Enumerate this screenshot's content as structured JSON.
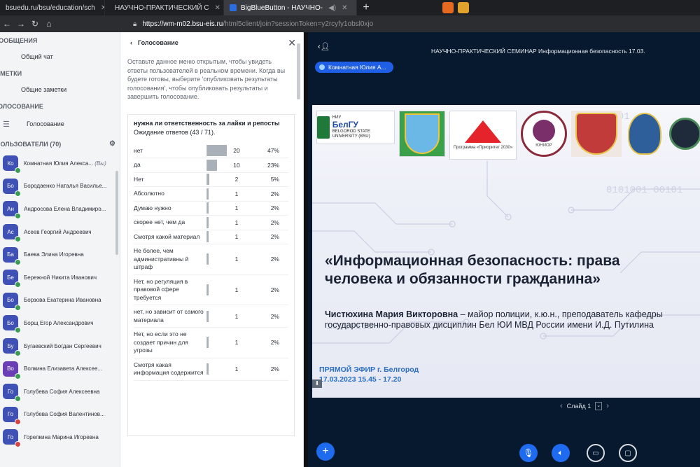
{
  "browser": {
    "tabs": [
      {
        "label": "bsuedu.ru/bsu/education/sch",
        "active": false
      },
      {
        "label": "НАУЧНО-ПРАКТИЧЕСКИЙ С",
        "active": false
      },
      {
        "label": "BigBlueButton - НАУЧНО-",
        "active": true
      }
    ],
    "new_tab": "+",
    "url_host": "https://wm-m02.bsu-eis.ru",
    "url_path": "/html5client/join?sessionToken=y2rcyfy1obsl0xjo"
  },
  "sidebar": {
    "messages_title": "СООБЩЕНИЯ",
    "public_chat": "Общий чат",
    "notes_title": "ЗАМЕТКИ",
    "shared_notes": "Общие заметки",
    "voting_title": "ГОЛОСОВАНИЕ",
    "voting_item": "Голосование",
    "users_title": "ПОЛЬЗОВАТЕЛИ (70)",
    "users": [
      {
        "initials": "Ко",
        "name": "Комнатная Юлия Алекса...",
        "suffix": "(Вы)",
        "color": "#3f51b5",
        "muted": false
      },
      {
        "initials": "Бо",
        "name": "Бородаенко Наталья Василье...",
        "suffix": "",
        "color": "#3f51b5",
        "muted": false
      },
      {
        "initials": "Ан",
        "name": "Андросова Елена Владимиро...",
        "suffix": "",
        "color": "#3f51b5",
        "muted": false
      },
      {
        "initials": "Ас",
        "name": "Асеев Георгий Андреевич",
        "suffix": "",
        "color": "#3f51b5",
        "muted": false
      },
      {
        "initials": "Ба",
        "name": "Баева Элина Игоревна",
        "suffix": "",
        "color": "#3f51b5",
        "muted": false
      },
      {
        "initials": "Бе",
        "name": "Бережной Никита Иванович",
        "suffix": "",
        "color": "#3f51b5",
        "muted": false
      },
      {
        "initials": "Бо",
        "name": "Борзова Екатерина Ивановна",
        "suffix": "",
        "color": "#3f51b5",
        "muted": false
      },
      {
        "initials": "Бо",
        "name": "Борщ Егор Александрович",
        "suffix": "",
        "color": "#3f51b5",
        "muted": false
      },
      {
        "initials": "Бу",
        "name": "Бугаевский Богдан Сергеевич",
        "suffix": "",
        "color": "#3f51b5",
        "muted": false
      },
      {
        "initials": "Во",
        "name": "Волкина Елизавета Алексее...",
        "suffix": "",
        "color": "#6a3fb5",
        "muted": false
      },
      {
        "initials": "Го",
        "name": "Голубева София Алексеевна",
        "suffix": "",
        "color": "#3f51b5",
        "muted": false
      },
      {
        "initials": "Го",
        "name": "Голубева София Валентинов...",
        "suffix": "",
        "color": "#3f51b5",
        "muted": true
      },
      {
        "initials": "Го",
        "name": "Горелкина Марина Игоревна",
        "suffix": "",
        "color": "#3f51b5",
        "muted": true
      }
    ]
  },
  "poll": {
    "title": "Голосование",
    "description": "Оставьте данное меню открытым, чтобы увидеть ответы пользователей в реальном времени. Когда вы будете готовы, выберите 'опубликовать результаты голосования', чтобы опубликовать результаты и завершить голосование.",
    "question": "нужна ли ответственность за лайки и репосты",
    "waiting": "Ожидание ответов (43 / 71).",
    "answers": [
      {
        "label": "нет",
        "count": "20",
        "percent": "47%",
        "fraction": 0.47
      },
      {
        "label": "да",
        "count": "10",
        "percent": "23%",
        "fraction": 0.23
      },
      {
        "label": "Нет",
        "count": "2",
        "percent": "5%",
        "fraction": 0.05
      },
      {
        "label": "Абсолютно",
        "count": "1",
        "percent": "2%",
        "fraction": 0.02
      },
      {
        "label": "Думаю нужно",
        "count": "1",
        "percent": "2%",
        "fraction": 0.02
      },
      {
        "label": "скорее нет, чем да",
        "count": "1",
        "percent": "2%",
        "fraction": 0.02
      },
      {
        "label": "Смотря какой материал",
        "count": "1",
        "percent": "2%",
        "fraction": 0.02
      },
      {
        "label": "Не более, чем административны й штраф",
        "count": "1",
        "percent": "2%",
        "fraction": 0.02
      },
      {
        "label": "Нет, но регуляция в правовой сфере требуется",
        "count": "1",
        "percent": "2%",
        "fraction": 0.02
      },
      {
        "label": "нет, но зависит от самого материала",
        "count": "1",
        "percent": "2%",
        "fraction": 0.02
      },
      {
        "label": "Нет, но если это не создает причин для угрозы",
        "count": "1",
        "percent": "2%",
        "fraction": 0.02
      },
      {
        "label": "Смотря какая информация содержится",
        "count": "1",
        "percent": "2%",
        "fraction": 0.02
      }
    ]
  },
  "main": {
    "session_title": "НАУЧНО-ПРАКТИЧЕСКИЙ СЕМИНАР Информационная безопасность 17.03.",
    "presenter": "Комнатная Юлия А...",
    "slide": {
      "logo_bgu_short": "БелГУ",
      "logo_bgu_prefix": "НИУ",
      "logo_bgu_caption": "BELGOROD STATE UNIVERSITY (BSU)",
      "logo_priority_caption": "Программа «Приоритет 2030»",
      "logo_round_caption": "ЮНИОР",
      "title": "«Информационная безопасность: права человека и обязанности гражданина»",
      "author_name": "Чистюхина Мария Викторовна",
      "author_details": " – майор полиции, к.ю.н., преподаватель кафедры государственно-правовых дисциплин Бел ЮИ МВД России имени И.Д. Путилина",
      "live": "ПРЯМОЙ ЭФИР г. Белгород",
      "datetime": "17.03.2023 15.45 - 17.20"
    },
    "slide_label": "Слайд 1"
  },
  "colors": {
    "accent": "#1f6bf0",
    "presenter_pill": "#1f5fe6",
    "main_bg": "#06192e",
    "live_text": "#2a6fc4"
  }
}
